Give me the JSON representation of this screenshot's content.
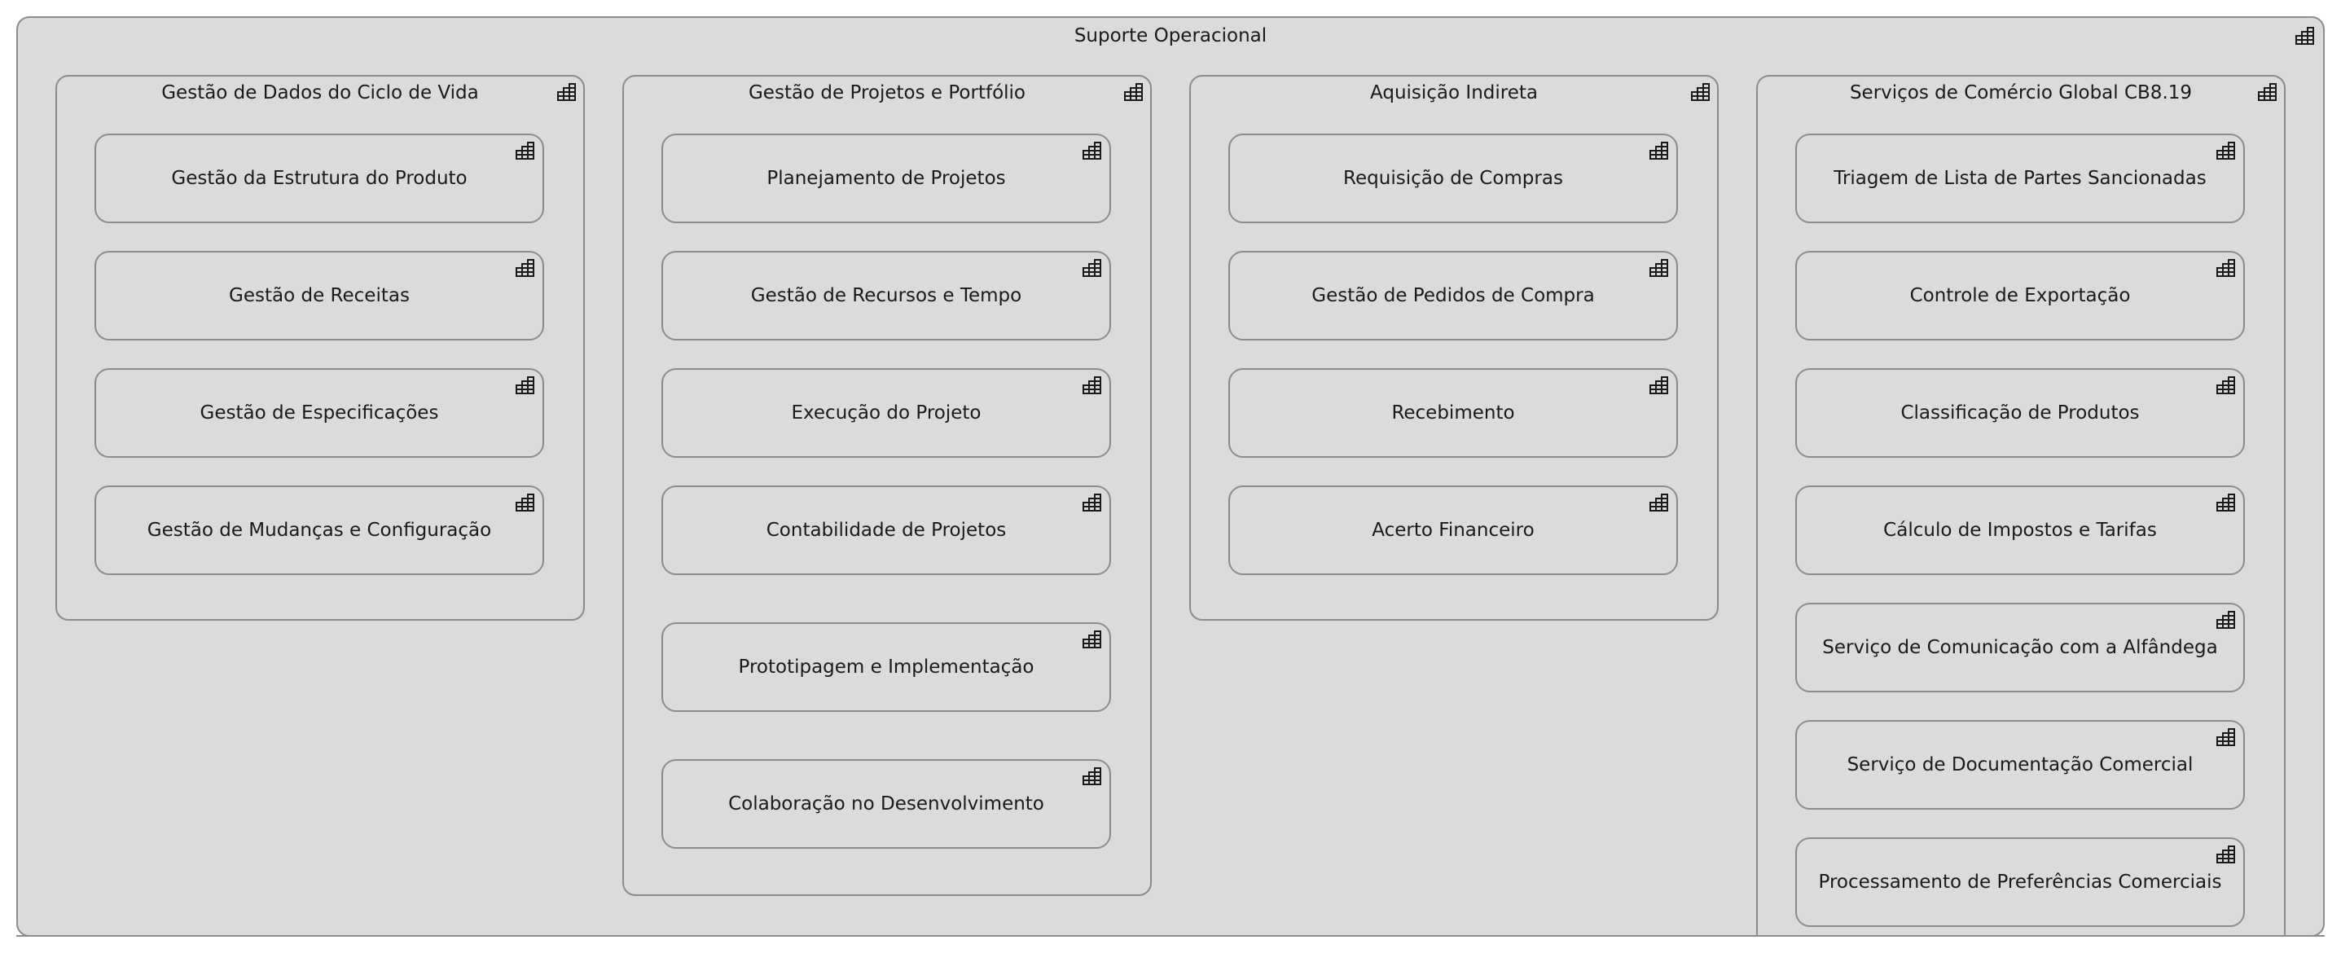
{
  "diagram": {
    "root": {
      "title": "Suporte Operacional",
      "icon": "capability-icon"
    },
    "groups": [
      {
        "title": "Gestão de Dados do Ciclo de Vida",
        "icon": "capability-icon",
        "items": [
          "Gestão da Estrutura do Produto",
          "Gestão de Receitas",
          "Gestão de Especificações",
          "Gestão de Mudanças e Configuração"
        ]
      },
      {
        "title": "Gestão de Projetos e Portfólio",
        "icon": "capability-icon",
        "items": [
          "Planejamento de Projetos",
          "Gestão de Recursos e Tempo",
          "Execução do Projeto",
          "Contabilidade de Projetos",
          "Prototipagem e Implementação",
          "Colaboração no Desenvolvimento"
        ]
      },
      {
        "title": "Aquisição Indireta",
        "icon": "capability-icon",
        "items": [
          "Requisição de Compras",
          "Gestão de Pedidos de Compra",
          "Recebimento",
          "Acerto Financeiro"
        ]
      },
      {
        "title": "Serviços de Comércio Global CB8.19",
        "icon": "capability-icon",
        "items": [
          "Triagem de Lista de Partes Sancionadas",
          "Controle de Exportação",
          "Classificação de Produtos",
          "Cálculo de Impostos e Tarifas",
          "Serviço de Comunicação com a Alfândega",
          "Serviço de Documentação Comercial",
          "Processamento de Preferências Comerciais"
        ]
      }
    ]
  }
}
